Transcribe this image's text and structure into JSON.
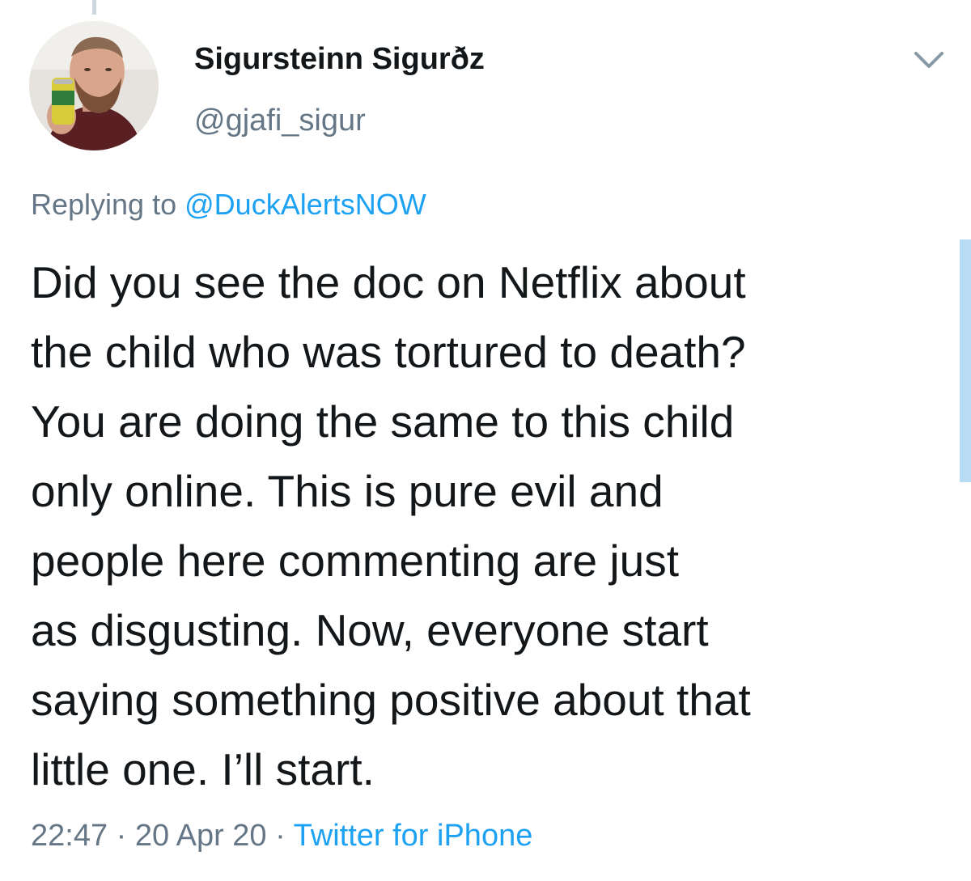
{
  "author": {
    "display_name": "Sigursteinn Sigurðz",
    "handle": "@gjafi_sigur",
    "avatar_icon": "profile-photo"
  },
  "reply": {
    "prefix": "Replying to",
    "mention": "@DuckAlertsNOW"
  },
  "tweet": {
    "lines": [
      "Did you see the doc on Netflix about",
      "the child who was tortured to death?",
      "You are doing the same to this child",
      "only online. This is pure evil and",
      "people here commenting are just",
      "as disgusting. Now, everyone start",
      "saying something positive about that",
      "little one. I’ll start."
    ]
  },
  "meta": {
    "time": "22:47",
    "separator": "·",
    "date": "20 Apr 20",
    "source": "Twitter for iPhone"
  },
  "colors": {
    "text": "#14171a",
    "secondary": "#657786",
    "link": "#1da1f2"
  }
}
